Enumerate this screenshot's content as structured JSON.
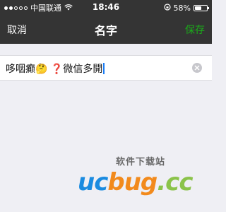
{
  "status_bar": {
    "carrier": "中国联通",
    "time": "18:46",
    "battery_percent": "58%",
    "battery_level": 0.58,
    "signal_bars_on": 2,
    "signal_bars_total": 5,
    "icons": [
      "wifi-icon",
      "rotation-lock-icon",
      "battery-icon"
    ]
  },
  "nav": {
    "cancel_label": "取消",
    "title": "名字",
    "save_label": "保存",
    "save_color": "#1aad19"
  },
  "name_field": {
    "value": "哆咽癫🤔 ❓微信多開"
  },
  "watermark": {
    "tagline": "软件下载站",
    "logo_uc": "uc",
    "logo_bug": "bug",
    "logo_suffix": ".cc"
  }
}
